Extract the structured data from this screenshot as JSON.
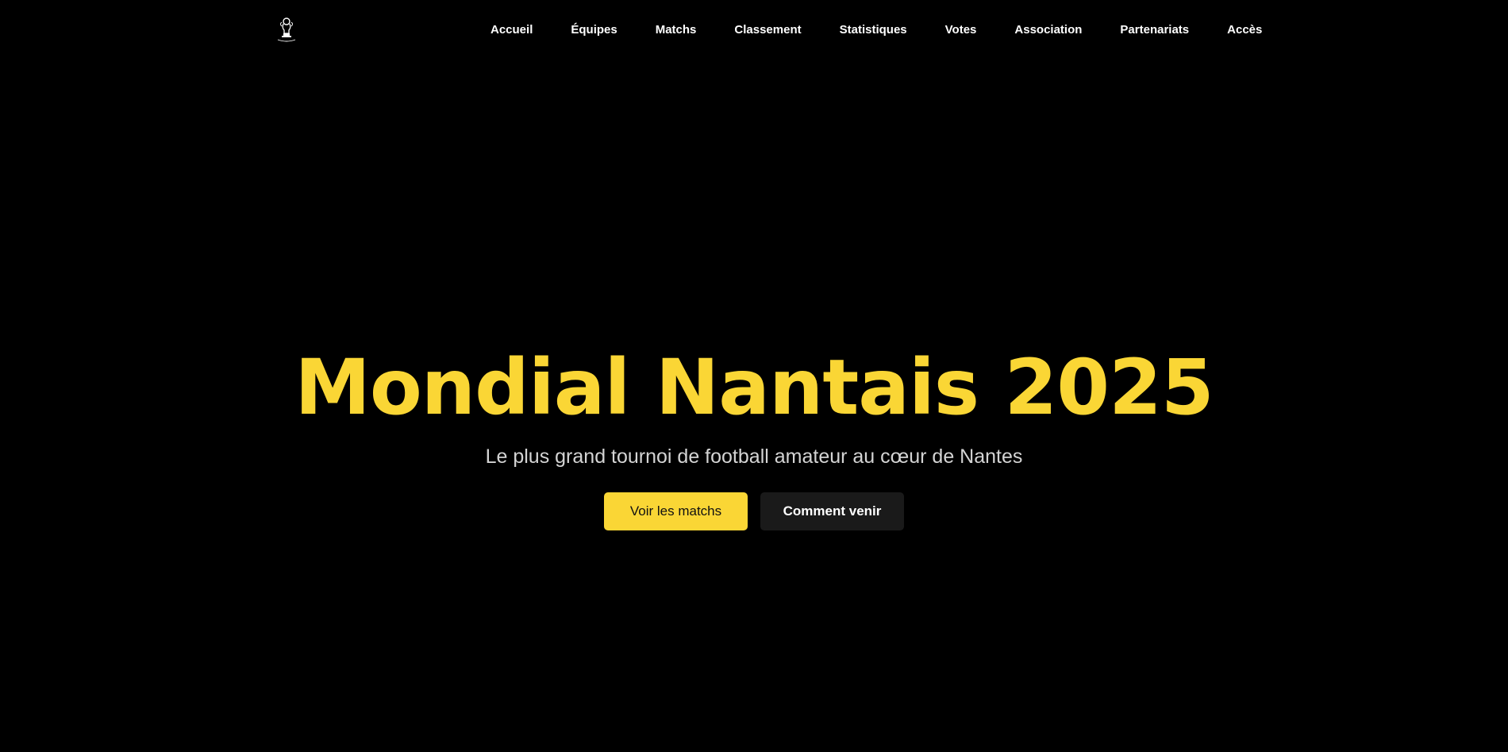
{
  "theme": {
    "background": "#000000",
    "accent": "#fad635",
    "subtitle_color": "#d4d4d4",
    "secondary_button_bg": "#1a1a1a"
  },
  "header": {
    "logo_icon": "trophy-logo-icon",
    "nav": [
      {
        "label": "Accueil"
      },
      {
        "label": "Équipes"
      },
      {
        "label": "Matchs"
      },
      {
        "label": "Classement"
      },
      {
        "label": "Statistiques"
      },
      {
        "label": "Votes"
      },
      {
        "label": "Association"
      },
      {
        "label": "Partenariats"
      },
      {
        "label": "Accès"
      }
    ]
  },
  "hero": {
    "title": "Mondial Nantais 2025",
    "subtitle": "Le plus grand tournoi de football amateur au cœur de Nantes",
    "primary_button": "Voir les matchs",
    "secondary_button": "Comment venir"
  }
}
